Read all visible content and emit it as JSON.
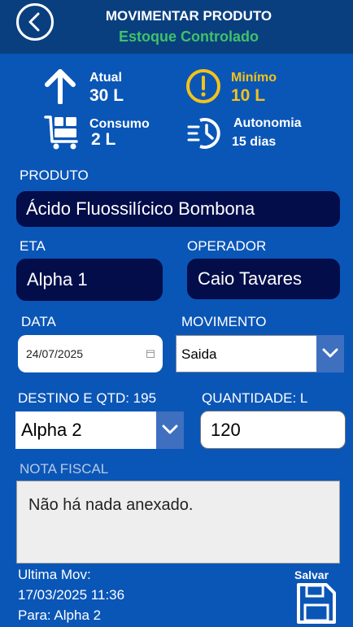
{
  "header": {
    "title": "MOVIMENTAR PRODUTO",
    "subtitle": "Estoque Controlado"
  },
  "stats": {
    "atual_label": "Atual",
    "atual_value": "30 L",
    "minimo_label": "Minímo",
    "minimo_value": "10 L",
    "consumo_label": "Consumo",
    "consumo_value": "2 L",
    "autonomia_label": "Autonomia",
    "autonomia_value": "15 dias"
  },
  "form": {
    "produto_label": "PRODUTO",
    "produto_value": "Ácido Fluossilícico Bombona",
    "eta_label": "ETA",
    "eta_value": "Alpha 1",
    "operador_label": "OPERADOR",
    "operador_value": "Caio Tavares",
    "data_label": "DATA",
    "data_value": "24/07/2025",
    "movimento_label": "MOVIMENTO",
    "movimento_value": "Saida",
    "destino_label": "DESTINO E QTD: 195",
    "destino_value": "Alpha 2",
    "quantidade_label": "QUANTIDADE: L",
    "quantidade_value": "120",
    "nota_label": "NOTA FISCAL",
    "nota_text": "Não há nada anexado."
  },
  "footer": {
    "ultima_label": "Ultima Mov:",
    "ultima_datetime": "17/03/2025 11:36",
    "para": "Para: Alpha 2",
    "salvar_label": "Salvar"
  },
  "colors": {
    "header_bg": "#0a3f7f",
    "body_bg": "#0a56b7",
    "accent_green": "#3dc26b",
    "accent_yellow": "#f4c21a",
    "field_dark": "#020d4a"
  }
}
